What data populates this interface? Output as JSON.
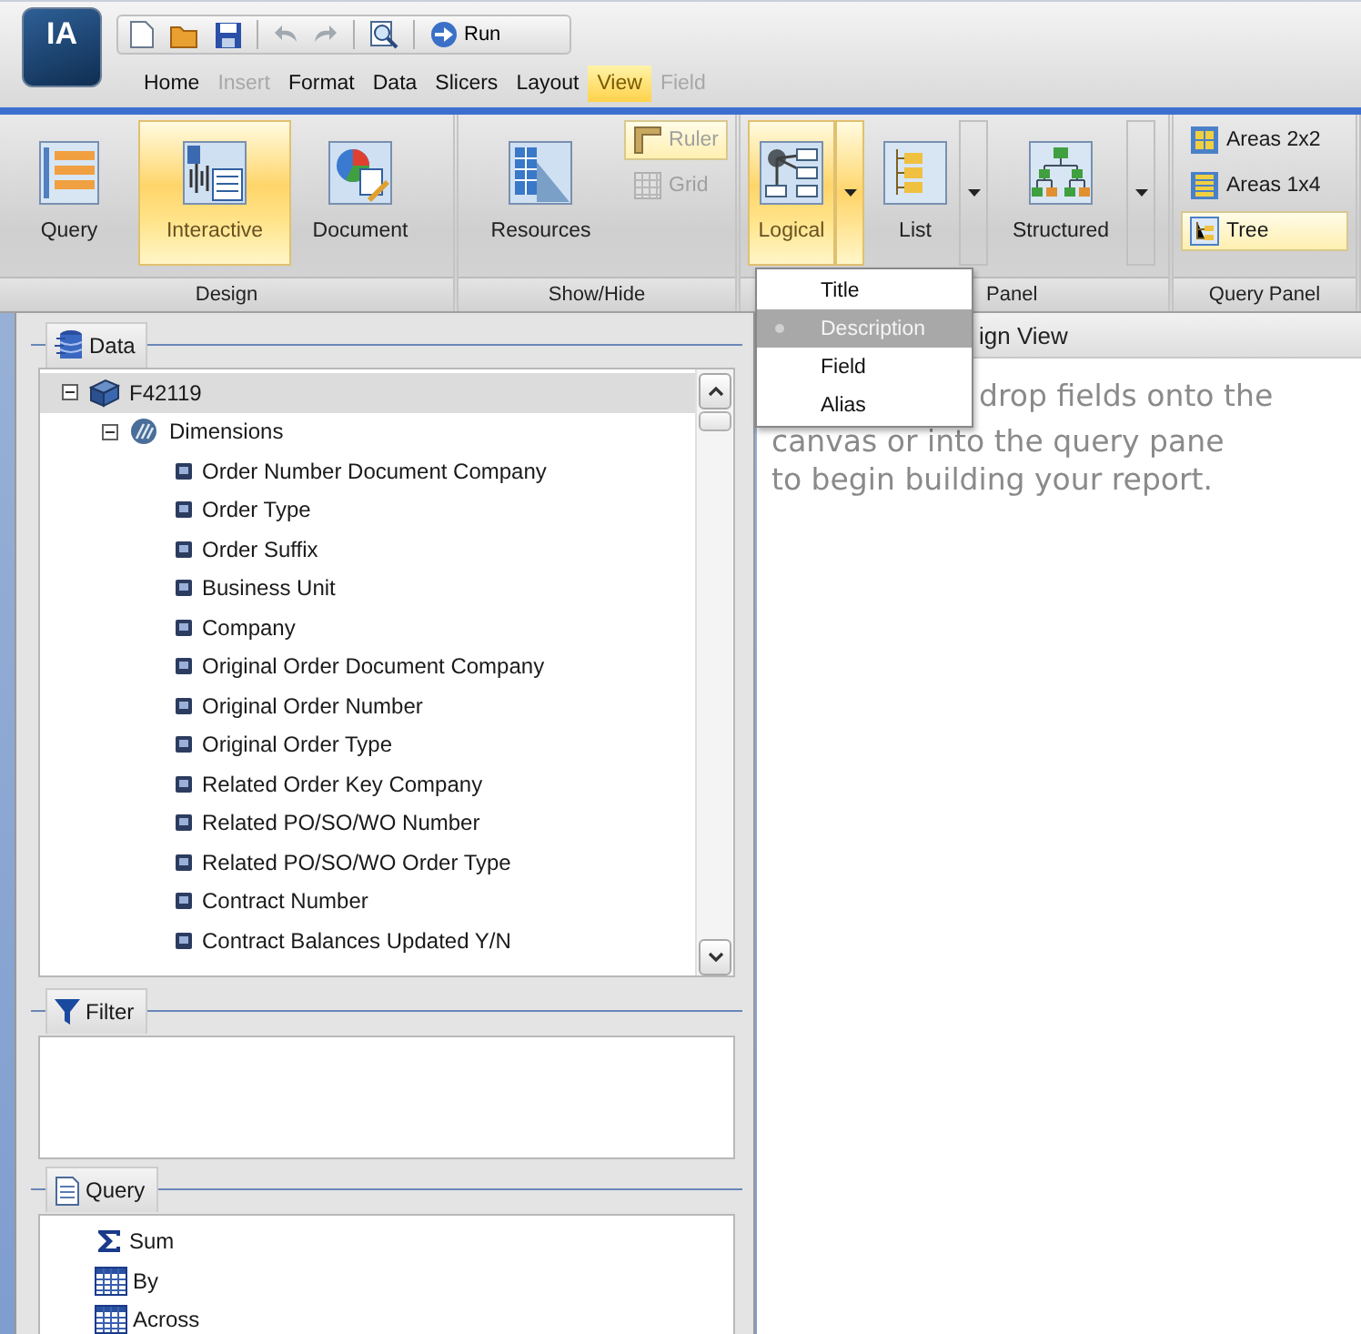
{
  "app_logo": {
    "text": "IA"
  },
  "quick_access": {
    "run_label": "Run"
  },
  "menu_tabs": [
    {
      "label": "Home",
      "selected": false,
      "disabled": false
    },
    {
      "label": "Insert",
      "selected": false,
      "disabled": true
    },
    {
      "label": "Format",
      "selected": false,
      "disabled": false
    },
    {
      "label": "Data",
      "selected": false,
      "disabled": false
    },
    {
      "label": "Slicers",
      "selected": false,
      "disabled": false
    },
    {
      "label": "Layout",
      "selected": false,
      "disabled": false
    },
    {
      "label": "View",
      "selected": true,
      "disabled": false
    },
    {
      "label": "Field",
      "selected": false,
      "disabled": true
    }
  ],
  "ribbon": {
    "groups": [
      {
        "label": "Design",
        "items": [
          {
            "kind": "large",
            "label": "Query",
            "selected": false,
            "disabled": false
          },
          {
            "kind": "large",
            "label": "Interactive",
            "selected": true,
            "disabled": false
          },
          {
            "kind": "large",
            "label": "Document",
            "selected": false,
            "disabled": false
          }
        ]
      },
      {
        "label": "Show/Hide",
        "items": [
          {
            "kind": "large",
            "label": "Resources",
            "selected": false,
            "disabled": false
          },
          {
            "kind": "small",
            "label": "Ruler",
            "selected": true,
            "disabled": true
          },
          {
            "kind": "small",
            "label": "Grid",
            "selected": false,
            "disabled": true
          }
        ]
      },
      {
        "label": "Panel",
        "items": [
          {
            "kind": "split",
            "label": "Logical",
            "selected": true,
            "disabled": false
          },
          {
            "kind": "split",
            "label": "List",
            "selected": false,
            "disabled": false
          },
          {
            "kind": "split",
            "label": "Structured",
            "selected": false,
            "disabled": false
          }
        ]
      },
      {
        "label": "Query Panel",
        "items": [
          {
            "kind": "small",
            "label": "Areas 2x2",
            "selected": false,
            "disabled": false
          },
          {
            "kind": "small",
            "label": "Areas 1x4",
            "selected": false,
            "disabled": false
          },
          {
            "kind": "small",
            "label": "Tree",
            "selected": true,
            "disabled": false
          }
        ]
      }
    ]
  },
  "dropdown_menu": [
    {
      "label": "Title",
      "selected": false
    },
    {
      "label": "Description",
      "selected": true
    },
    {
      "label": "Field",
      "selected": false
    },
    {
      "label": "Alias",
      "selected": false
    }
  ],
  "data_panel": {
    "title": "Data",
    "tree": [
      {
        "label": "F42119",
        "kind": "table",
        "expanded": true,
        "selected": true,
        "children": [
          {
            "label": "Dimensions",
            "kind": "folder",
            "expanded": true,
            "selected": false,
            "children": [
              {
                "label": "Order Number Document Company",
                "kind": "field",
                "selected": false
              },
              {
                "label": "Order Type",
                "kind": "field",
                "selected": false
              },
              {
                "label": "Order Suffix",
                "kind": "field",
                "selected": false
              },
              {
                "label": "Business Unit",
                "kind": "field",
                "selected": false
              },
              {
                "label": "Company",
                "kind": "field",
                "selected": false
              },
              {
                "label": "Original Order Document Company",
                "kind": "field",
                "selected": false
              },
              {
                "label": "Original Order Number",
                "kind": "field",
                "selected": false
              },
              {
                "label": "Original Order Type",
                "kind": "field",
                "selected": false
              },
              {
                "label": "Related Order Key Company",
                "kind": "field",
                "selected": false
              },
              {
                "label": "Related PO/SO/WO Number",
                "kind": "field",
                "selected": false
              },
              {
                "label": "Related PO/SO/WO Order Type",
                "kind": "field",
                "selected": false
              },
              {
                "label": "Contract Number",
                "kind": "field",
                "selected": false
              },
              {
                "label": "Contract Balances Updated Y/N",
                "kind": "field",
                "selected": false
              }
            ]
          }
        ]
      }
    ]
  },
  "filter_panel": {
    "title": "Filter"
  },
  "query_panel": {
    "title": "Query",
    "items": [
      {
        "label": "Sum",
        "kind": "sum"
      },
      {
        "label": "By",
        "kind": "grid"
      },
      {
        "label": "Across",
        "kind": "grid"
      }
    ]
  },
  "design_view": {
    "header": "ign View",
    "hint_lines": [
      "drop fields onto the",
      "canvas or into the query pane",
      "to begin building your report."
    ]
  }
}
